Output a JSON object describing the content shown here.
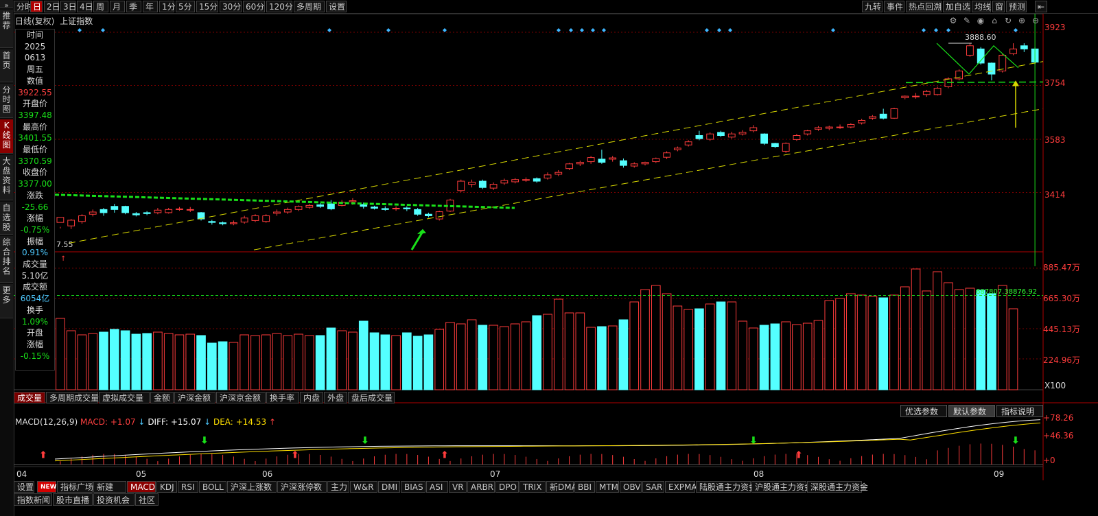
{
  "toolbar": {
    "items": [
      "分时",
      "日",
      "2日",
      "3日",
      "4日",
      "周",
      "月",
      "季",
      "年",
      "1分",
      "5分",
      "15分",
      "30分",
      "60分",
      "120分",
      "多周期",
      "设置"
    ],
    "right_items": [
      "九转",
      "事件",
      "热点回溯",
      "加自选",
      "均线",
      "窗",
      "预测"
    ]
  },
  "left_nav": [
    "推荐",
    "首页",
    "分时图",
    "K线图",
    "大盘资料",
    "自选股",
    "综合排名",
    "更多"
  ],
  "chart_header": {
    "mode": "日线(复权)",
    "index_name": "上证指数"
  },
  "info_panel": [
    {
      "label": "时间",
      "value": "2025"
    },
    {
      "label": "",
      "value": "0613"
    },
    {
      "label": "周五",
      "value": ""
    },
    {
      "label": "数值",
      "value": "3922.55"
    },
    {
      "label": "开盘价",
      "value": "3397.48"
    },
    {
      "label": "最高价",
      "value": "3401.55"
    },
    {
      "label": "最低价",
      "value": "3370.59"
    },
    {
      "label": "收盘价",
      "value": "3377.00"
    },
    {
      "label": "涨跌",
      "value": "-25.66"
    },
    {
      "label": "涨幅",
      "value": "-0.75%"
    },
    {
      "label": "振幅",
      "value": "0.91%"
    },
    {
      "label": "成交量",
      "value": "5.10亿"
    },
    {
      "label": "成交额",
      "value": "6054亿"
    },
    {
      "label": "换手",
      "value": "1.09%"
    },
    {
      "label": "开盘",
      "value": ""
    },
    {
      "label": "涨幅",
      "value": "-0.15%"
    }
  ],
  "price_axis": [
    "3923",
    "3754",
    "3583",
    "3414"
  ],
  "price_annotations": {
    "high_label": "3888.60",
    "left_low_label": "7.55"
  },
  "volume_axis": [
    "885.47万",
    "665.30万",
    "445.13万",
    "224.96万",
    "X100"
  ],
  "volume_annotation": "687807.38876.92",
  "volume_tabs": [
    "成交量",
    "多周期成交量",
    "虚拟成交量",
    "金额",
    "沪深金额",
    "沪深京金额",
    "换手率",
    "内盘",
    "外盘",
    "盘后成交量"
  ],
  "macd": {
    "title": "MACD(12,26,9)",
    "macd_label": "MACD:",
    "macd_value": "+1.07",
    "diff_label": "DIFF:",
    "diff_value": "+15.07",
    "dea_label": "DEA:",
    "dea_value": "+14.53",
    "axis": [
      "+78.26",
      "+46.36",
      "+0"
    ],
    "buttons": [
      "优选参数",
      "默认参数",
      "指标说明"
    ]
  },
  "time_axis": [
    "04",
    "05",
    "06",
    "07",
    "08",
    "09"
  ],
  "indicator_tabs": [
    "设置",
    "NEW",
    "指标广场",
    "新建",
    "MACD",
    "KDJ",
    "RSI",
    "BOLL",
    "沪深上涨数",
    "沪深涨停数",
    "主力",
    "W&R",
    "DMI",
    "BIAS",
    "ASI",
    "VR",
    "ARBR",
    "DPO",
    "TRIX",
    "新DMA",
    "BBI",
    "MTM",
    "OBV",
    "SAR",
    "EXPMA",
    "陆股通主力资金",
    "沪股通主力资金",
    "深股通主力资金"
  ],
  "bottom_tabs": [
    "指数新闻",
    "股市直播",
    "投资机会",
    "社区"
  ],
  "chart_data": {
    "type": "candlestick",
    "price_ylim": [
      3230,
      3960
    ],
    "candles": [
      [
        3319,
        3335,
        3305,
        3300
      ],
      [
        3308,
        3326,
        3330,
        3298
      ],
      [
        3322,
        3340,
        3345,
        3315
      ],
      [
        3345,
        3352,
        3360,
        3338
      ],
      [
        3360,
        3350,
        3365,
        3340
      ],
      [
        3370,
        3360,
        3378,
        3350
      ],
      [
        3370,
        3350,
        3372,
        3345
      ],
      [
        3347,
        3343,
        3352,
        3338
      ],
      [
        3350,
        3347,
        3355,
        3342
      ],
      [
        3350,
        3358,
        3365,
        3345
      ],
      [
        3350,
        3360,
        3365,
        3347
      ],
      [
        3362,
        3362,
        3368,
        3356
      ],
      [
        3358,
        3360,
        3368,
        3352
      ],
      [
        3350,
        3330,
        3352,
        3325
      ],
      [
        3322,
        3319,
        3327,
        3312
      ],
      [
        3318,
        3315,
        3322,
        3310
      ],
      [
        3315,
        3318,
        3325,
        3310
      ],
      [
        3320,
        3333,
        3340,
        3315
      ],
      [
        3325,
        3340,
        3345,
        3320
      ],
      [
        3322,
        3340,
        3345,
        3318
      ],
      [
        3348,
        3352,
        3360,
        3340
      ],
      [
        3352,
        3360,
        3366,
        3346
      ],
      [
        3360,
        3370,
        3373,
        3355
      ],
      [
        3367,
        3373,
        3378,
        3362
      ],
      [
        3375,
        3370,
        3380,
        3365
      ],
      [
        3378,
        3362,
        3390,
        3358
      ],
      [
        3373,
        3383,
        3390,
        3370
      ],
      [
        3385,
        3388,
        3396,
        3375
      ],
      [
        3376,
        3370,
        3382,
        3363
      ],
      [
        3368,
        3364,
        3372,
        3360
      ],
      [
        3363,
        3360,
        3370,
        3356
      ],
      [
        3362,
        3364,
        3370,
        3356
      ],
      [
        3365,
        3362,
        3370,
        3355
      ],
      [
        3360,
        3345,
        3365,
        3340
      ],
      [
        3345,
        3340,
        3350,
        3335
      ],
      [
        3330,
        3353,
        3356,
        3325
      ],
      [
        3355,
        3390,
        3394,
        3352
      ],
      [
        3420,
        3450,
        3455,
        3415
      ],
      [
        3440,
        3447,
        3455,
        3430
      ],
      [
        3450,
        3430,
        3455,
        3425
      ],
      [
        3428,
        3440,
        3446,
        3422
      ],
      [
        3444,
        3452,
        3458,
        3438
      ],
      [
        3448,
        3455,
        3460,
        3443
      ],
      [
        3455,
        3455,
        3462,
        3448
      ],
      [
        3458,
        3450,
        3462,
        3445
      ],
      [
        3460,
        3470,
        3478,
        3455
      ],
      [
        3472,
        3478,
        3485,
        3466
      ],
      [
        3490,
        3505,
        3508,
        3485
      ],
      [
        3505,
        3510,
        3515,
        3498
      ],
      [
        3512,
        3525,
        3530,
        3505
      ],
      [
        3520,
        3510,
        3550,
        3505
      ],
      [
        3520,
        3524,
        3530,
        3512
      ],
      [
        3515,
        3500,
        3522,
        3493
      ],
      [
        3498,
        3505,
        3510,
        3493
      ],
      [
        3505,
        3510,
        3512,
        3500
      ],
      [
        3512,
        3522,
        3525,
        3508
      ],
      [
        3526,
        3540,
        3545,
        3520
      ],
      [
        3550,
        3555,
        3560,
        3545
      ],
      [
        3565,
        3575,
        3580,
        3560
      ],
      [
        3595,
        3585,
        3610,
        3580
      ],
      [
        3583,
        3600,
        3605,
        3578
      ],
      [
        3605,
        3595,
        3610,
        3590
      ],
      [
        3590,
        3600,
        3607,
        3585
      ],
      [
        3600,
        3605,
        3612,
        3595
      ],
      [
        3610,
        3620,
        3628,
        3605
      ],
      [
        3600,
        3570,
        3602,
        3565
      ],
      [
        3570,
        3560,
        3572,
        3555
      ],
      [
        3545,
        3570,
        3573,
        3540
      ],
      [
        3582,
        3595,
        3600,
        3578
      ],
      [
        3600,
        3610,
        3613,
        3595
      ],
      [
        3615,
        3620,
        3625,
        3610
      ],
      [
        3618,
        3622,
        3626,
        3612
      ],
      [
        3622,
        3622,
        3630,
        3616
      ],
      [
        3622,
        3630,
        3634,
        3618
      ],
      [
        3635,
        3643,
        3648,
        3630
      ],
      [
        3650,
        3655,
        3660,
        3645
      ],
      [
        3663,
        3650,
        3680,
        3646
      ],
      [
        3650,
        3680,
        3683,
        3648
      ],
      [
        3715,
        3720,
        3722,
        3710
      ],
      [
        3720,
        3720,
        3730,
        3712
      ],
      [
        3725,
        3735,
        3740,
        3718
      ],
      [
        3725,
        3745,
        3750,
        3722
      ],
      [
        3750,
        3775,
        3780,
        3745
      ],
      [
        3775,
        3800,
        3805,
        3770
      ],
      [
        3850,
        3880,
        3888,
        3845
      ],
      [
        3870,
        3825,
        3876,
        3820
      ],
      [
        3825,
        3790,
        3827,
        3770
      ],
      [
        3800,
        3850,
        3855,
        3795
      ],
      [
        3855,
        3870,
        3888,
        3850
      ],
      [
        3880,
        3870,
        3888,
        3860
      ],
      [
        3870,
        3828,
        3875,
        3820
      ]
    ],
    "volumes": [
      520,
      430,
      400,
      410,
      420,
      440,
      430,
      405,
      410,
      420,
      410,
      400,
      405,
      395,
      340,
      350,
      345,
      400,
      395,
      400,
      410,
      395,
      405,
      395,
      395,
      450,
      430,
      420,
      500,
      415,
      400,
      395,
      415,
      390,
      400,
      440,
      490,
      480,
      510,
      470,
      470,
      460,
      480,
      495,
      540,
      550,
      660,
      560,
      560,
      455,
      460,
      465,
      510,
      640,
      730,
      760,
      700,
      610,
      585,
      590,
      625,
      640,
      640,
      500,
      450,
      470,
      480,
      495,
      475,
      485,
      505,
      650,
      665,
      700,
      690,
      680,
      670,
      690,
      750,
      880,
      720,
      860,
      780,
      730,
      740,
      725,
      700,
      760,
      590
    ],
    "volume_ylim": [
      0,
      940
    ],
    "ma_volume": 687.81,
    "macd_ylim": [
      -10,
      90
    ]
  }
}
